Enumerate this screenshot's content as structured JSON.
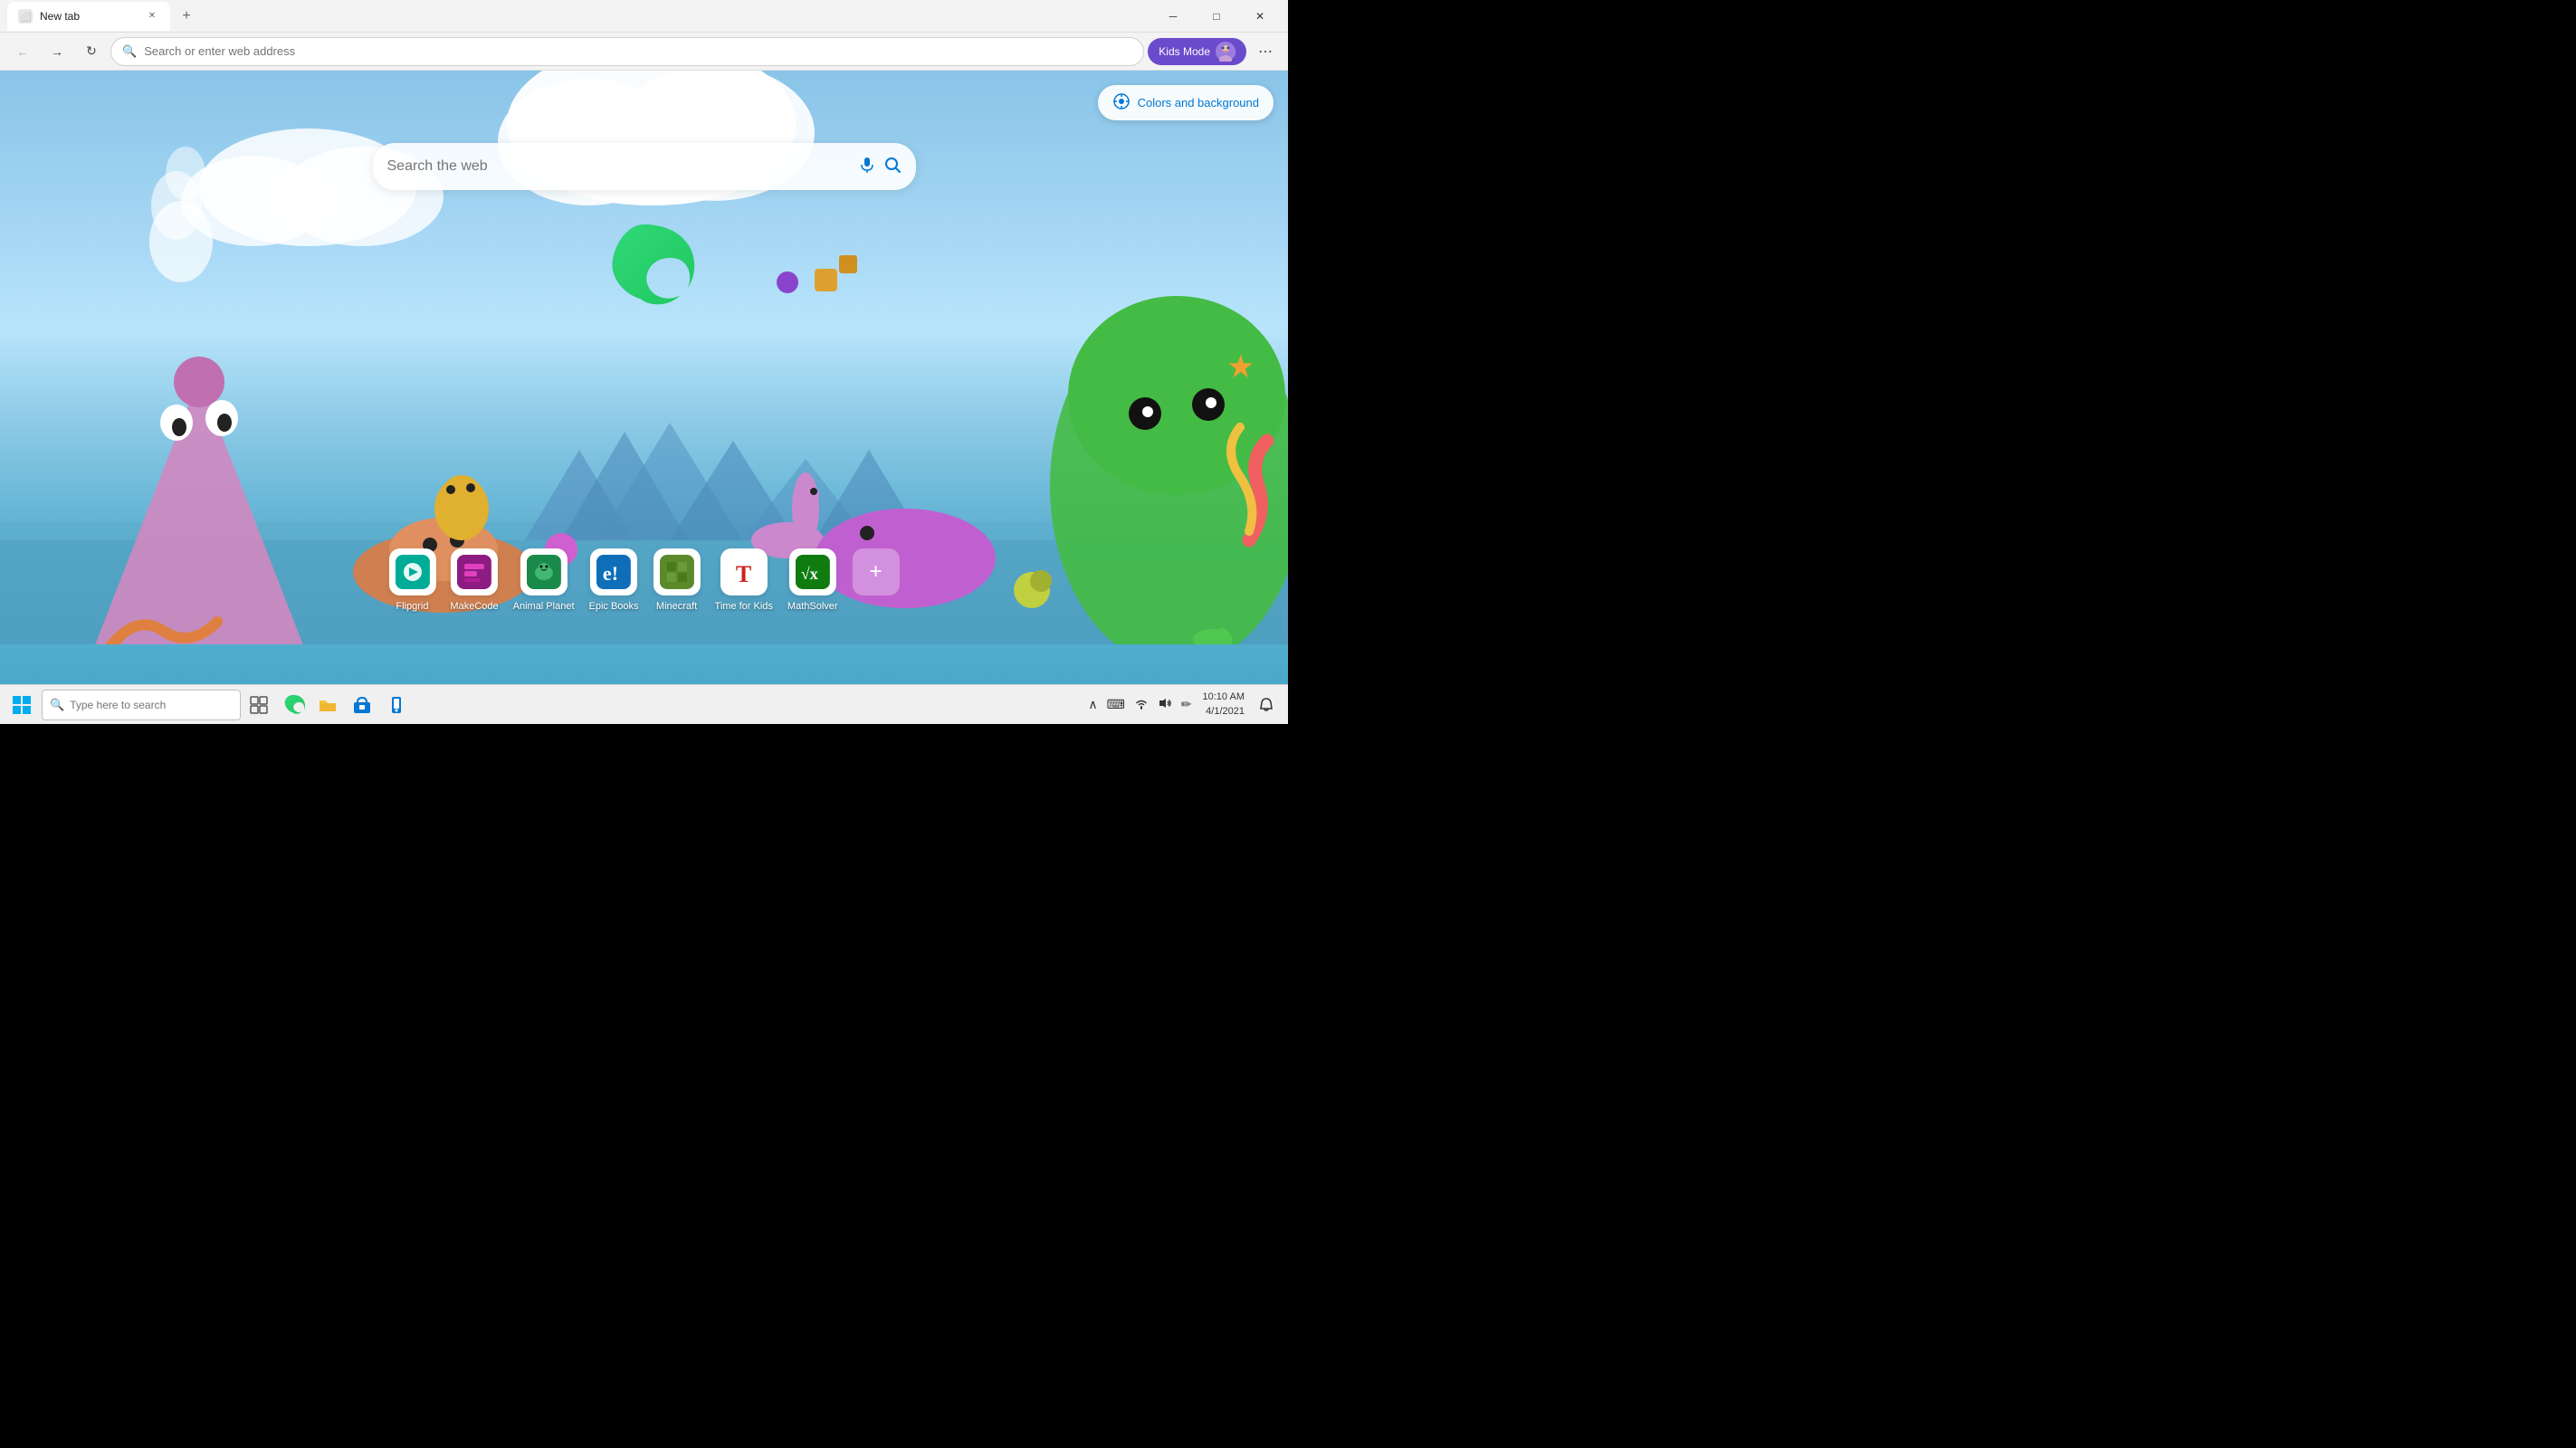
{
  "browser": {
    "tab": {
      "title": "New tab",
      "favicon": "🌐"
    },
    "address_bar": {
      "placeholder": "Search or enter web address"
    },
    "kids_mode_label": "Kids Mode",
    "nav_buttons": {
      "back": "←",
      "forward": "→",
      "refresh": "↻"
    },
    "more_icon": "⋯",
    "new_tab_icon": "+"
  },
  "newtab": {
    "colors_background_btn": "Colors and background",
    "search_placeholder": "Search the web",
    "quick_links": [
      {
        "label": "Flipgrid",
        "icon": "fg",
        "bg": "#00ac97"
      },
      {
        "label": "MakeCode",
        "icon": "mk",
        "bg": "#8c1c82"
      },
      {
        "label": "Animal Planet",
        "icon": "ap",
        "bg": "#1a8a4a"
      },
      {
        "label": "Epic Books",
        "icon": "eb",
        "bg": "#0e6eb8"
      },
      {
        "label": "Minecraft",
        "icon": "mc",
        "bg": "#5a8a2a"
      },
      {
        "label": "Time for Kids",
        "icon": "T",
        "bg": "#cc2222"
      },
      {
        "label": "MathSolver",
        "icon": "ms",
        "bg": "#107c10"
      }
    ]
  },
  "taskbar": {
    "search_placeholder": "Type here to search",
    "start_icon": "⊞",
    "time": "10:10 AM",
    "date": "4/1/2021",
    "icons": [
      "⊞",
      "🔍",
      "⧉",
      "🌐",
      "📁",
      "🛍",
      "📱"
    ],
    "tray_icons": [
      "^",
      "⌨",
      "📶",
      "🔊",
      "✏"
    ],
    "notification_icon": "🔔"
  }
}
